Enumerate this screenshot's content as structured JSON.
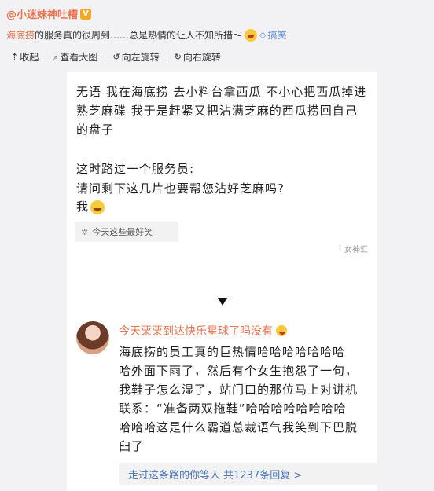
{
  "author": {
    "name": "@小迷妹神吐槽",
    "badge": "V"
  },
  "post": {
    "link_text": "海底捞",
    "body": "的服务真的很周到……总是热情的让人不知所措～",
    "tag": "搞笑"
  },
  "toolbar": {
    "collapse": "收起",
    "view_large": "查看大图",
    "rotate_left": "向左旋转",
    "rotate_right": "向右旋转"
  },
  "image": {
    "card1": {
      "line1": "无语 我在海底捞 去小料台拿西瓜 不小心把西瓜掉进",
      "line2": "熟芝麻碟 我于是赶紧又把沾满芝麻的西瓜捞回自己",
      "line3": "的盘子",
      "line4": "这时路过一个服务员:",
      "line5": "请问剩下这几片也要帮您沾好芝麻吗?",
      "line6": "我",
      "pill": "今天这些最好笑",
      "watermark": "女神汇"
    },
    "card2": {
      "name": "今天栗栗到达快乐星球了吗没有",
      "lines": [
        "海底捞的员工真的巨热情哈哈哈哈哈哈哈",
        "哈外面下雨了，然后有个女生抱怨了一句，",
        "我鞋子怎么湿了，站门口的那位马上对讲机",
        "联系：“准备两双拖鞋”哈哈哈哈哈哈哈哈",
        "哈哈哈这是什么霸道总裁语气我笑到下巴脱",
        "臼了"
      ],
      "more": "走过这条路的你等人  共1237条回复 >"
    }
  }
}
